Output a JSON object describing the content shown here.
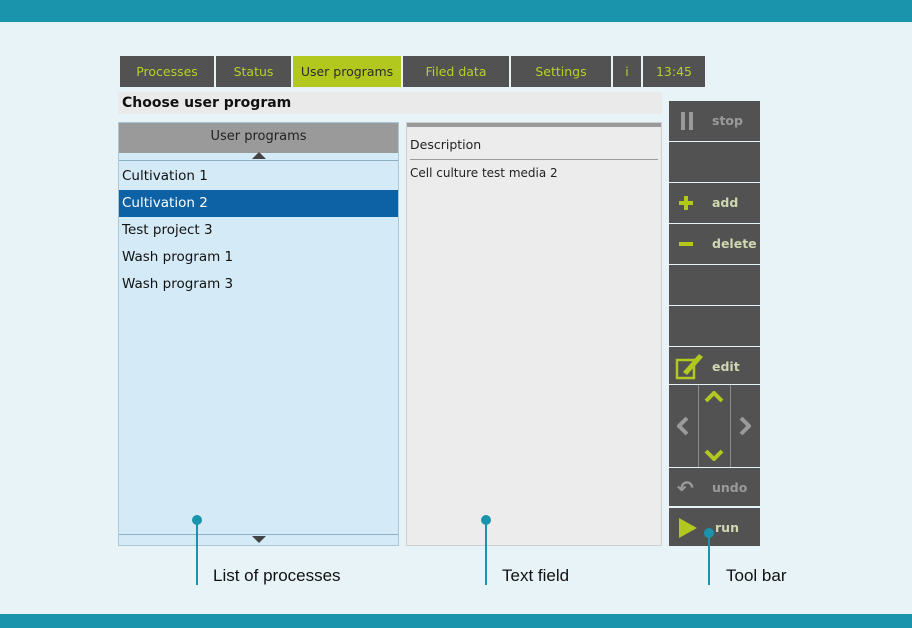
{
  "tabs": [
    {
      "label": "Processes",
      "active": false
    },
    {
      "label": "Status",
      "active": false
    },
    {
      "label": "User programs",
      "active": true
    },
    {
      "label": "Filed data",
      "active": false
    },
    {
      "label": "Settings",
      "active": false
    },
    {
      "label": "i",
      "active": false
    },
    {
      "label": "13:45",
      "active": false
    }
  ],
  "page_title": "Choose user program",
  "list": {
    "header": "User programs",
    "items": [
      "Cultivation 1",
      "Cultivation 2",
      "Test project 3",
      "Wash program 1",
      "Wash program 3"
    ],
    "selected_index": 1
  },
  "description": {
    "header": "Description",
    "text": "Cell culture test media 2"
  },
  "toolbar": {
    "stop": "stop",
    "add": "add",
    "delete": "delete",
    "edit": "edit",
    "undo": "undo",
    "run": "run",
    "icons": [
      "pause-icon",
      "plus-icon",
      "minus-icon",
      "edit-icon",
      "chevron-up-icon",
      "chevron-left-icon",
      "chevron-right-icon",
      "chevron-down-icon",
      "undo-icon",
      "play-icon"
    ]
  },
  "callouts": {
    "list": "List of processes",
    "text": "Text field",
    "toolbar": "Tool bar"
  },
  "colors": {
    "accent": "#b2c81f",
    "band": "#1a94ad",
    "selection": "#0d62a6",
    "dark": "#525252"
  }
}
